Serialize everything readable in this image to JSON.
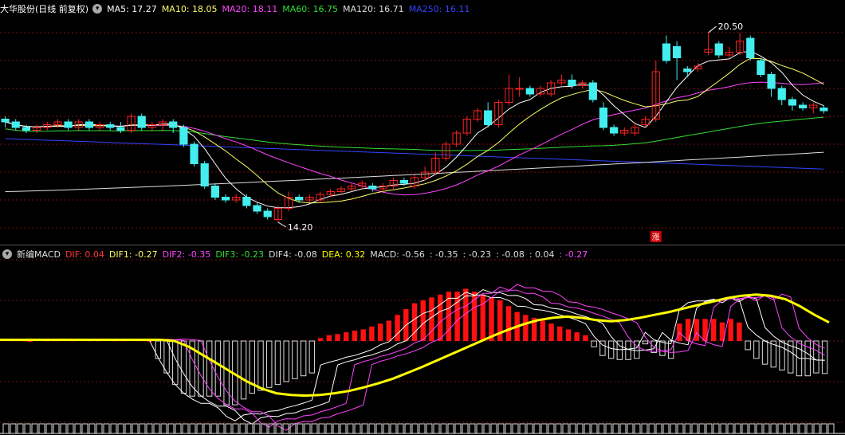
{
  "price_legend": {
    "title": "大华股份(日线 前复权)",
    "items": [
      {
        "label": "MA5: 17.27",
        "color": "#ffffff"
      },
      {
        "label": "MA10: 18.05",
        "color": "#ffff66"
      },
      {
        "label": "MA20: 18.11",
        "color": "#ff44ff"
      },
      {
        "label": "MA60: 16.75",
        "color": "#33dd33"
      },
      {
        "label": "MA120: 16.71",
        "color": "#dddddd"
      },
      {
        "label": "MA250: 16.11",
        "color": "#3344ff"
      }
    ]
  },
  "indicator_legend": {
    "title": "新编MACD",
    "items": [
      {
        "label": "DIF: 0.04",
        "color": "#ff3333"
      },
      {
        "label": "DIF1: -0.27",
        "color": "#ffff66"
      },
      {
        "label": "DIF2: -0.35",
        "color": "#ff44ff"
      },
      {
        "label": "DIF3: -0.23",
        "color": "#33dd33"
      },
      {
        "label": "DIF4: -0.08",
        "color": "#dddddd"
      },
      {
        "label": "DEA: 0.32",
        "color": "#ffff00"
      },
      {
        "label": "MACD: -0.56",
        "color": "#dddddd"
      },
      {
        "label": ": -0.35",
        "color": "#dddddd"
      },
      {
        "label": ": -0.23",
        "color": "#dddddd"
      },
      {
        "label": ": -0.08",
        "color": "#dddddd"
      },
      {
        "label": ": 0.04",
        "color": "#dddddd"
      },
      {
        "label": ": -0.27",
        "color": "#ff44ff"
      }
    ]
  },
  "annotations": {
    "high_label": "20.50",
    "low_label": "14.20",
    "limit_up_badge": "涨"
  },
  "chart_data": [
    {
      "type": "candlestick",
      "title": "大华股份(日线 前复权)",
      "ylim": [
        13.6,
        21.6
      ],
      "up_color": "#ff2222",
      "down_color": "#44eeee",
      "candles": [
        [
          17.9,
          17.8,
          18.0,
          17.6
        ],
        [
          17.8,
          17.6,
          17.9,
          17.5
        ],
        [
          17.6,
          17.5,
          17.7,
          17.4
        ],
        [
          17.5,
          17.6,
          17.7,
          17.4
        ],
        [
          17.6,
          17.7,
          17.8,
          17.5
        ],
        [
          17.7,
          17.8,
          17.9,
          17.6
        ],
        [
          17.8,
          17.6,
          17.9,
          17.5
        ],
        [
          17.6,
          17.8,
          17.9,
          17.5
        ],
        [
          17.8,
          17.6,
          17.9,
          17.5
        ],
        [
          17.6,
          17.7,
          17.8,
          17.5
        ],
        [
          17.7,
          17.6,
          17.8,
          17.5
        ],
        [
          17.6,
          17.5,
          17.8,
          17.4
        ],
        [
          17.5,
          18.0,
          18.1,
          17.4
        ],
        [
          18.0,
          17.6,
          18.1,
          17.5
        ],
        [
          17.6,
          17.7,
          17.8,
          17.5
        ],
        [
          17.7,
          17.8,
          17.9,
          17.5
        ],
        [
          17.8,
          17.6,
          17.9,
          17.4
        ],
        [
          17.6,
          17.0,
          17.7,
          16.9
        ],
        [
          17.0,
          16.3,
          17.1,
          16.2
        ],
        [
          16.3,
          15.5,
          16.4,
          15.4
        ],
        [
          15.5,
          15.1,
          15.6,
          15.0
        ],
        [
          15.1,
          15.0,
          15.2,
          14.9
        ],
        [
          15.0,
          15.1,
          15.2,
          14.9
        ],
        [
          15.1,
          14.8,
          15.2,
          14.7
        ],
        [
          14.8,
          14.6,
          14.9,
          14.5
        ],
        [
          14.6,
          14.4,
          14.7,
          14.3
        ],
        [
          14.3,
          14.7,
          14.8,
          14.2
        ],
        [
          14.7,
          15.1,
          15.3,
          14.6
        ],
        [
          15.1,
          15.0,
          15.2,
          14.9
        ],
        [
          15.0,
          15.1,
          15.2,
          14.9
        ],
        [
          15.0,
          15.2,
          15.3,
          14.9
        ],
        [
          15.2,
          15.3,
          15.4,
          15.1
        ],
        [
          15.3,
          15.4,
          15.5,
          15.2
        ],
        [
          15.4,
          15.5,
          15.6,
          15.3
        ],
        [
          15.5,
          15.6,
          15.7,
          15.4
        ],
        [
          15.5,
          15.4,
          15.6,
          15.3
        ],
        [
          15.4,
          15.5,
          15.6,
          15.3
        ],
        [
          15.5,
          15.7,
          15.8,
          15.4
        ],
        [
          15.7,
          15.6,
          15.8,
          15.5
        ],
        [
          15.5,
          15.8,
          15.9,
          15.4
        ],
        [
          15.8,
          16.0,
          16.2,
          15.7
        ],
        [
          16.0,
          16.5,
          16.7,
          15.9
        ],
        [
          16.5,
          17.0,
          17.1,
          16.4
        ],
        [
          17.0,
          17.4,
          17.5,
          16.9
        ],
        [
          17.4,
          17.9,
          18.0,
          17.3
        ],
        [
          17.9,
          18.2,
          18.3,
          17.8
        ],
        [
          18.2,
          17.7,
          18.5,
          17.6
        ],
        [
          17.7,
          18.5,
          18.6,
          17.6
        ],
        [
          18.5,
          19.0,
          19.5,
          18.4
        ],
        [
          19.0,
          19.0,
          19.4,
          18.7
        ],
        [
          19.0,
          18.8,
          19.1,
          18.7
        ],
        [
          18.8,
          19.0,
          19.1,
          18.7
        ],
        [
          18.8,
          19.2,
          19.3,
          18.7
        ],
        [
          19.2,
          19.3,
          19.5,
          19.1
        ],
        [
          19.3,
          19.1,
          19.5,
          19.0
        ],
        [
          19.1,
          19.2,
          19.3,
          19.0
        ],
        [
          19.2,
          18.6,
          19.3,
          18.5
        ],
        [
          18.3,
          17.6,
          18.5,
          17.5
        ],
        [
          17.6,
          17.4,
          17.7,
          17.3
        ],
        [
          17.4,
          17.5,
          17.6,
          17.3
        ],
        [
          17.4,
          17.6,
          17.8,
          17.3
        ],
        [
          17.7,
          17.9,
          18.0,
          17.6
        ],
        [
          17.9,
          19.6,
          20.0,
          17.8
        ],
        [
          20.6,
          20.0,
          20.9,
          19.9
        ],
        [
          20.5,
          20.1,
          20.7,
          19.3
        ],
        [
          19.7,
          19.6,
          19.8,
          19.4
        ],
        [
          19.7,
          19.8,
          19.9,
          19.6
        ],
        [
          20.3,
          20.4,
          21.0,
          20.2
        ],
        [
          20.6,
          20.2,
          20.7,
          20.1
        ],
        [
          20.2,
          20.3,
          20.5,
          20.1
        ],
        [
          20.3,
          20.7,
          21.0,
          20.2
        ],
        [
          20.8,
          20.1,
          20.9,
          20.0
        ],
        [
          20.0,
          19.5,
          20.1,
          19.4
        ],
        [
          19.5,
          19.0,
          19.6,
          18.7
        ],
        [
          19.0,
          18.6,
          19.1,
          18.4
        ],
        [
          18.6,
          18.4,
          18.7,
          18.2
        ],
        [
          18.4,
          18.3,
          18.5,
          18.2
        ],
        [
          18.3,
          18.4,
          18.5,
          18.1
        ],
        [
          18.3,
          18.2,
          18.4,
          18.1
        ]
      ],
      "ma_values": {
        "MA5": 17.27,
        "MA10": 18.05,
        "MA20": 18.11,
        "MA60": 16.75,
        "MA120": 16.71,
        "MA250": 16.11
      },
      "high": 20.5,
      "low": 14.2
    },
    {
      "type": "bar",
      "title": "新编MACD",
      "ylim": [
        -1.4,
        1.4
      ],
      "macd_bars": [
        0.02,
        0.01,
        0.01,
        0,
        0.02,
        0.01,
        0.01,
        0.02,
        0.01,
        0.02,
        0.01,
        0.01,
        0.02,
        0.01,
        0.01,
        0.02,
        0.01,
        0,
        -0.3,
        -0.55,
        -0.75,
        -0.9,
        -0.95,
        -0.95,
        -0.95,
        -0.95,
        -1.1,
        -1.1,
        -1.0,
        -0.9,
        -0.85,
        -0.8,
        -0.75,
        -0.7,
        -0.65,
        -0.6,
        -0.55,
        0.05,
        0.1,
        0.12,
        0.15,
        0.18,
        0.2,
        0.25,
        0.3,
        0.35,
        0.45,
        0.55,
        0.65,
        0.7,
        0.75,
        0.8,
        0.85,
        0.85,
        0.9,
        0.85,
        0.8,
        0.75,
        0.7,
        0.6,
        0.5,
        0.45,
        0.4,
        0.35,
        0.3,
        0.25,
        0.2,
        0.15,
        0.1,
        -0.1,
        -0.25,
        -0.3,
        -0.32,
        -0.32,
        -0.3,
        -0.05,
        -0.2,
        -0.25,
        -0.3,
        0.3,
        0.38,
        0.38,
        0.38,
        0.38,
        0.32,
        0.38,
        0.32,
        -0.15,
        -0.3,
        -0.4,
        -0.45,
        -0.5,
        -0.55,
        -0.6,
        -0.6,
        -0.55,
        -0.56
      ],
      "dea": [
        0.02,
        0.02,
        0.02,
        0.02,
        0.02,
        0.02,
        0.02,
        0.02,
        0.02,
        0.02,
        0.02,
        0.02,
        0.0,
        -0.1,
        -0.25,
        -0.4,
        -0.55,
        -0.7,
        -0.82,
        -0.9,
        -0.93,
        -0.94,
        -0.93,
        -0.9,
        -0.86,
        -0.8,
        -0.73,
        -0.65,
        -0.55,
        -0.45,
        -0.34,
        -0.23,
        -0.12,
        -0.01,
        0.1,
        0.2,
        0.29,
        0.36,
        0.4,
        0.42,
        0.4,
        0.36,
        0.34,
        0.36,
        0.4,
        0.45,
        0.5,
        0.56,
        0.62,
        0.68,
        0.74,
        0.78,
        0.8,
        0.78,
        0.72,
        0.6,
        0.45,
        0.32
      ]
    }
  ]
}
